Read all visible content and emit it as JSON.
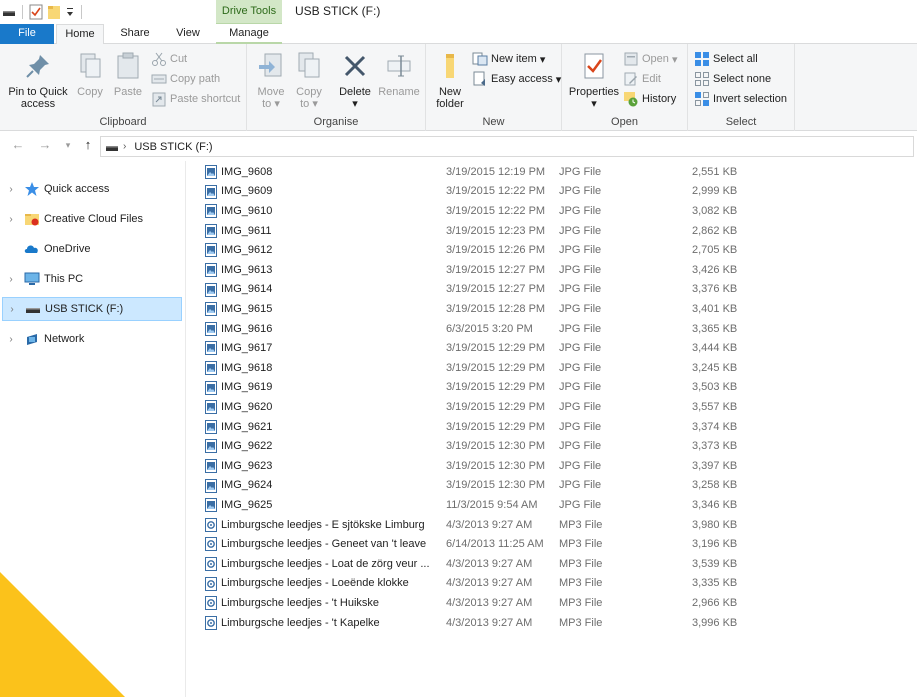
{
  "window": {
    "title": "USB STICK (F:)",
    "context_tab": "Drive Tools"
  },
  "tabs": {
    "file": "File",
    "home": "Home",
    "share": "Share",
    "view": "View",
    "manage": "Manage"
  },
  "ribbon": {
    "clipboard": {
      "label": "Clipboard",
      "pin_line1": "Pin to Quick",
      "pin_line2": "access",
      "copy": "Copy",
      "paste": "Paste",
      "cut": "Cut",
      "copy_path": "Copy path",
      "paste_shortcut": "Paste shortcut"
    },
    "organise": {
      "label": "Organise",
      "move_line1": "Move",
      "move_line2": "to",
      "copy_line1": "Copy",
      "copy_line2": "to",
      "delete": "Delete",
      "rename": "Rename"
    },
    "new": {
      "label": "New",
      "folder_line1": "New",
      "folder_line2": "folder",
      "new_item": "New item",
      "easy_access": "Easy access"
    },
    "open": {
      "label": "Open",
      "properties": "Properties",
      "open": "Open",
      "edit": "Edit",
      "history": "History"
    },
    "select": {
      "label": "Select",
      "select_all": "Select all",
      "select_none": "Select none",
      "invert": "Invert selection"
    }
  },
  "address": {
    "path": "USB STICK (F:)"
  },
  "nav": [
    {
      "label": "Quick access"
    },
    {
      "label": "Creative Cloud Files"
    },
    {
      "label": "OneDrive"
    },
    {
      "label": "This PC"
    },
    {
      "label": "USB STICK (F:)"
    },
    {
      "label": "Network"
    }
  ],
  "files": [
    {
      "name": "IMG_9608",
      "date": "3/19/2015 12:19 PM",
      "type": "JPG File",
      "size": "2,551 KB",
      "kind": "jpg"
    },
    {
      "name": "IMG_9609",
      "date": "3/19/2015 12:22 PM",
      "type": "JPG File",
      "size": "2,999 KB",
      "kind": "jpg"
    },
    {
      "name": "IMG_9610",
      "date": "3/19/2015 12:22 PM",
      "type": "JPG File",
      "size": "3,082 KB",
      "kind": "jpg"
    },
    {
      "name": "IMG_9611",
      "date": "3/19/2015 12:23 PM",
      "type": "JPG File",
      "size": "2,862 KB",
      "kind": "jpg"
    },
    {
      "name": "IMG_9612",
      "date": "3/19/2015 12:26 PM",
      "type": "JPG File",
      "size": "2,705 KB",
      "kind": "jpg"
    },
    {
      "name": "IMG_9613",
      "date": "3/19/2015 12:27 PM",
      "type": "JPG File",
      "size": "3,426 KB",
      "kind": "jpg"
    },
    {
      "name": "IMG_9614",
      "date": "3/19/2015 12:27 PM",
      "type": "JPG File",
      "size": "3,376 KB",
      "kind": "jpg"
    },
    {
      "name": "IMG_9615",
      "date": "3/19/2015 12:28 PM",
      "type": "JPG File",
      "size": "3,401 KB",
      "kind": "jpg"
    },
    {
      "name": "IMG_9616",
      "date": "6/3/2015 3:20 PM",
      "type": "JPG File",
      "size": "3,365 KB",
      "kind": "jpg"
    },
    {
      "name": "IMG_9617",
      "date": "3/19/2015 12:29 PM",
      "type": "JPG File",
      "size": "3,444 KB",
      "kind": "jpg"
    },
    {
      "name": "IMG_9618",
      "date": "3/19/2015 12:29 PM",
      "type": "JPG File",
      "size": "3,245 KB",
      "kind": "jpg"
    },
    {
      "name": "IMG_9619",
      "date": "3/19/2015 12:29 PM",
      "type": "JPG File",
      "size": "3,503 KB",
      "kind": "jpg"
    },
    {
      "name": "IMG_9620",
      "date": "3/19/2015 12:29 PM",
      "type": "JPG File",
      "size": "3,557 KB",
      "kind": "jpg"
    },
    {
      "name": "IMG_9621",
      "date": "3/19/2015 12:29 PM",
      "type": "JPG File",
      "size": "3,374 KB",
      "kind": "jpg"
    },
    {
      "name": "IMG_9622",
      "date": "3/19/2015 12:30 PM",
      "type": "JPG File",
      "size": "3,373 KB",
      "kind": "jpg"
    },
    {
      "name": "IMG_9623",
      "date": "3/19/2015 12:30 PM",
      "type": "JPG File",
      "size": "3,397 KB",
      "kind": "jpg"
    },
    {
      "name": "IMG_9624",
      "date": "3/19/2015 12:30 PM",
      "type": "JPG File",
      "size": "3,258 KB",
      "kind": "jpg"
    },
    {
      "name": "IMG_9625",
      "date": "11/3/2015 9:54 AM",
      "type": "JPG File",
      "size": "3,346 KB",
      "kind": "jpg"
    },
    {
      "name": "Limburgsche leedjes - E sjtökske Limburg",
      "date": "4/3/2013 9:27 AM",
      "type": "MP3 File",
      "size": "3,980 KB",
      "kind": "mp3"
    },
    {
      "name": "Limburgsche leedjes - Geneet van 't leave",
      "date": "6/14/2013 11:25 AM",
      "type": "MP3 File",
      "size": "3,196 KB",
      "kind": "mp3"
    },
    {
      "name": "Limburgsche leedjes - Loat de zörg veur ...",
      "date": "4/3/2013 9:27 AM",
      "type": "MP3 File",
      "size": "3,539 KB",
      "kind": "mp3"
    },
    {
      "name": "Limburgsche leedjes - Loeënde klokke",
      "date": "4/3/2013 9:27 AM",
      "type": "MP3 File",
      "size": "3,335 KB",
      "kind": "mp3"
    },
    {
      "name": "Limburgsche leedjes - 't Huikske",
      "date": "4/3/2013 9:27 AM",
      "type": "MP3 File",
      "size": "2,966 KB",
      "kind": "mp3"
    },
    {
      "name": "Limburgsche leedjes - 't Kapelke",
      "date": "4/3/2013 9:27 AM",
      "type": "MP3 File",
      "size": "3,996 KB",
      "kind": "mp3"
    }
  ],
  "colors": {
    "file_tab": "#1979ca",
    "drive_tools": "#d3e7c7",
    "selection": "#cce8ff",
    "corner_accent": "#fbc21b"
  }
}
